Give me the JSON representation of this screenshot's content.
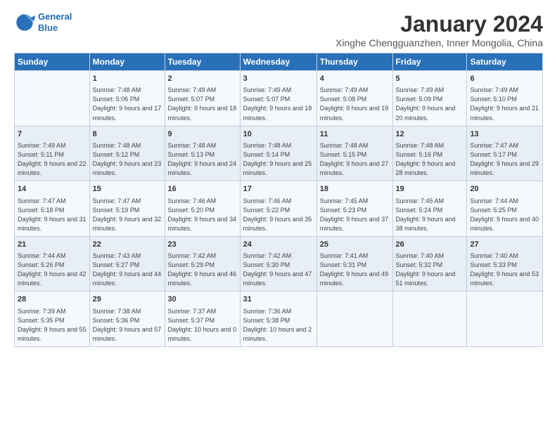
{
  "header": {
    "logo_line1": "General",
    "logo_line2": "Blue",
    "title": "January 2024",
    "subtitle": "Xinghe Chengguanzhen, Inner Mongolia, China"
  },
  "columns": [
    "Sunday",
    "Monday",
    "Tuesday",
    "Wednesday",
    "Thursday",
    "Friday",
    "Saturday"
  ],
  "weeks": [
    [
      {
        "day": "",
        "sunrise": "",
        "sunset": "",
        "daylight": ""
      },
      {
        "day": "1",
        "sunrise": "Sunrise: 7:48 AM",
        "sunset": "Sunset: 5:06 PM",
        "daylight": "Daylight: 9 hours and 17 minutes."
      },
      {
        "day": "2",
        "sunrise": "Sunrise: 7:49 AM",
        "sunset": "Sunset: 5:07 PM",
        "daylight": "Daylight: 9 hours and 18 minutes."
      },
      {
        "day": "3",
        "sunrise": "Sunrise: 7:49 AM",
        "sunset": "Sunset: 5:07 PM",
        "daylight": "Daylight: 9 hours and 18 minutes."
      },
      {
        "day": "4",
        "sunrise": "Sunrise: 7:49 AM",
        "sunset": "Sunset: 5:08 PM",
        "daylight": "Daylight: 9 hours and 19 minutes."
      },
      {
        "day": "5",
        "sunrise": "Sunrise: 7:49 AM",
        "sunset": "Sunset: 5:09 PM",
        "daylight": "Daylight: 9 hours and 20 minutes."
      },
      {
        "day": "6",
        "sunrise": "Sunrise: 7:49 AM",
        "sunset": "Sunset: 5:10 PM",
        "daylight": "Daylight: 9 hours and 21 minutes."
      }
    ],
    [
      {
        "day": "7",
        "sunrise": "Sunrise: 7:49 AM",
        "sunset": "Sunset: 5:11 PM",
        "daylight": "Daylight: 9 hours and 22 minutes."
      },
      {
        "day": "8",
        "sunrise": "Sunrise: 7:48 AM",
        "sunset": "Sunset: 5:12 PM",
        "daylight": "Daylight: 9 hours and 23 minutes."
      },
      {
        "day": "9",
        "sunrise": "Sunrise: 7:48 AM",
        "sunset": "Sunset: 5:13 PM",
        "daylight": "Daylight: 9 hours and 24 minutes."
      },
      {
        "day": "10",
        "sunrise": "Sunrise: 7:48 AM",
        "sunset": "Sunset: 5:14 PM",
        "daylight": "Daylight: 9 hours and 25 minutes."
      },
      {
        "day": "11",
        "sunrise": "Sunrise: 7:48 AM",
        "sunset": "Sunset: 5:15 PM",
        "daylight": "Daylight: 9 hours and 27 minutes."
      },
      {
        "day": "12",
        "sunrise": "Sunrise: 7:48 AM",
        "sunset": "Sunset: 5:16 PM",
        "daylight": "Daylight: 9 hours and 28 minutes."
      },
      {
        "day": "13",
        "sunrise": "Sunrise: 7:47 AM",
        "sunset": "Sunset: 5:17 PM",
        "daylight": "Daylight: 9 hours and 29 minutes."
      }
    ],
    [
      {
        "day": "14",
        "sunrise": "Sunrise: 7:47 AM",
        "sunset": "Sunset: 5:18 PM",
        "daylight": "Daylight: 9 hours and 31 minutes."
      },
      {
        "day": "15",
        "sunrise": "Sunrise: 7:47 AM",
        "sunset": "Sunset: 5:19 PM",
        "daylight": "Daylight: 9 hours and 32 minutes."
      },
      {
        "day": "16",
        "sunrise": "Sunrise: 7:46 AM",
        "sunset": "Sunset: 5:20 PM",
        "daylight": "Daylight: 9 hours and 34 minutes."
      },
      {
        "day": "17",
        "sunrise": "Sunrise: 7:46 AM",
        "sunset": "Sunset: 5:22 PM",
        "daylight": "Daylight: 9 hours and 35 minutes."
      },
      {
        "day": "18",
        "sunrise": "Sunrise: 7:45 AM",
        "sunset": "Sunset: 5:23 PM",
        "daylight": "Daylight: 9 hours and 37 minutes."
      },
      {
        "day": "19",
        "sunrise": "Sunrise: 7:45 AM",
        "sunset": "Sunset: 5:24 PM",
        "daylight": "Daylight: 9 hours and 38 minutes."
      },
      {
        "day": "20",
        "sunrise": "Sunrise: 7:44 AM",
        "sunset": "Sunset: 5:25 PM",
        "daylight": "Daylight: 9 hours and 40 minutes."
      }
    ],
    [
      {
        "day": "21",
        "sunrise": "Sunrise: 7:44 AM",
        "sunset": "Sunset: 5:26 PM",
        "daylight": "Daylight: 9 hours and 42 minutes."
      },
      {
        "day": "22",
        "sunrise": "Sunrise: 7:43 AM",
        "sunset": "Sunset: 5:27 PM",
        "daylight": "Daylight: 9 hours and 44 minutes."
      },
      {
        "day": "23",
        "sunrise": "Sunrise: 7:42 AM",
        "sunset": "Sunset: 5:29 PM",
        "daylight": "Daylight: 9 hours and 46 minutes."
      },
      {
        "day": "24",
        "sunrise": "Sunrise: 7:42 AM",
        "sunset": "Sunset: 5:30 PM",
        "daylight": "Daylight: 9 hours and 47 minutes."
      },
      {
        "day": "25",
        "sunrise": "Sunrise: 7:41 AM",
        "sunset": "Sunset: 5:31 PM",
        "daylight": "Daylight: 9 hours and 49 minutes."
      },
      {
        "day": "26",
        "sunrise": "Sunrise: 7:40 AM",
        "sunset": "Sunset: 5:32 PM",
        "daylight": "Daylight: 9 hours and 51 minutes."
      },
      {
        "day": "27",
        "sunrise": "Sunrise: 7:40 AM",
        "sunset": "Sunset: 5:33 PM",
        "daylight": "Daylight: 9 hours and 53 minutes."
      }
    ],
    [
      {
        "day": "28",
        "sunrise": "Sunrise: 7:39 AM",
        "sunset": "Sunset: 5:35 PM",
        "daylight": "Daylight: 9 hours and 55 minutes."
      },
      {
        "day": "29",
        "sunrise": "Sunrise: 7:38 AM",
        "sunset": "Sunset: 5:36 PM",
        "daylight": "Daylight: 9 hours and 57 minutes."
      },
      {
        "day": "30",
        "sunrise": "Sunrise: 7:37 AM",
        "sunset": "Sunset: 5:37 PM",
        "daylight": "Daylight: 10 hours and 0 minutes."
      },
      {
        "day": "31",
        "sunrise": "Sunrise: 7:36 AM",
        "sunset": "Sunset: 5:38 PM",
        "daylight": "Daylight: 10 hours and 2 minutes."
      },
      {
        "day": "",
        "sunrise": "",
        "sunset": "",
        "daylight": ""
      },
      {
        "day": "",
        "sunrise": "",
        "sunset": "",
        "daylight": ""
      },
      {
        "day": "",
        "sunrise": "",
        "sunset": "",
        "daylight": ""
      }
    ]
  ]
}
